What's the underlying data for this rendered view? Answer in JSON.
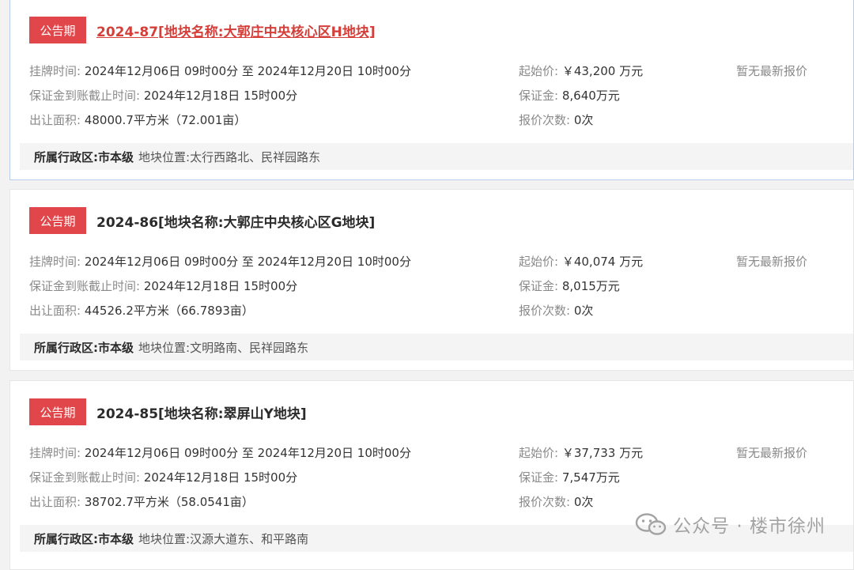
{
  "listings": [
    {
      "status": "公告期",
      "title": "2024-87[地块名称:大郭庄中央核心区H地块]",
      "listing_time_label": "挂牌时间:",
      "listing_time": "2024年12月06日 09时00分 至 2024年12月20日 10时00分",
      "deposit_deadline_label": "保证金到账截止时间:",
      "deposit_deadline": "2024年12月18日 15时00分",
      "area_label": "出让面积:",
      "area": "48000.7平方米（72.001亩）",
      "start_price_label": "起始价:",
      "start_price": "￥43,200 万元",
      "deposit_label": "保证金:",
      "deposit": "8,640万元",
      "bid_count_label": "报价次数:",
      "bid_count": "0次",
      "latest_bid": "暂无最新报价",
      "district_label": "所属行政区:",
      "district": "市本级",
      "location_label": "地块位置:",
      "location": "太行西路北、民祥园路东"
    },
    {
      "status": "公告期",
      "title": "2024-86[地块名称:大郭庄中央核心区G地块]",
      "listing_time_label": "挂牌时间:",
      "listing_time": "2024年12月06日 09时00分 至 2024年12月20日 10时00分",
      "deposit_deadline_label": "保证金到账截止时间:",
      "deposit_deadline": "2024年12月18日 15时00分",
      "area_label": "出让面积:",
      "area": "44526.2平方米（66.7893亩）",
      "start_price_label": "起始价:",
      "start_price": "￥40,074 万元",
      "deposit_label": "保证金:",
      "deposit": "8,015万元",
      "bid_count_label": "报价次数:",
      "bid_count": "0次",
      "latest_bid": "暂无最新报价",
      "district_label": "所属行政区:",
      "district": "市本级",
      "location_label": "地块位置:",
      "location": "文明路南、民祥园路东"
    },
    {
      "status": "公告期",
      "title": "2024-85[地块名称:翠屏山Y地块]",
      "listing_time_label": "挂牌时间:",
      "listing_time": "2024年12月06日 09时00分 至 2024年12月20日 10时00分",
      "deposit_deadline_label": "保证金到账截止时间:",
      "deposit_deadline": "2024年12月18日 15时00分",
      "area_label": "出让面积:",
      "area": "38702.7平方米（58.0541亩）",
      "start_price_label": "起始价:",
      "start_price": "￥37,733 万元",
      "deposit_label": "保证金:",
      "deposit": "7,547万元",
      "bid_count_label": "报价次数:",
      "bid_count": "0次",
      "latest_bid": "暂无最新报价",
      "district_label": "所属行政区:",
      "district": "市本级",
      "location_label": "地块位置:",
      "location": "汉源大道东、和平路南"
    }
  ],
  "watermark": {
    "text": "公众号 · 楼市徐州",
    "icon": "wechat-icon"
  },
  "colors": {
    "badge": "#e1474a",
    "link": "#d43f3a"
  }
}
